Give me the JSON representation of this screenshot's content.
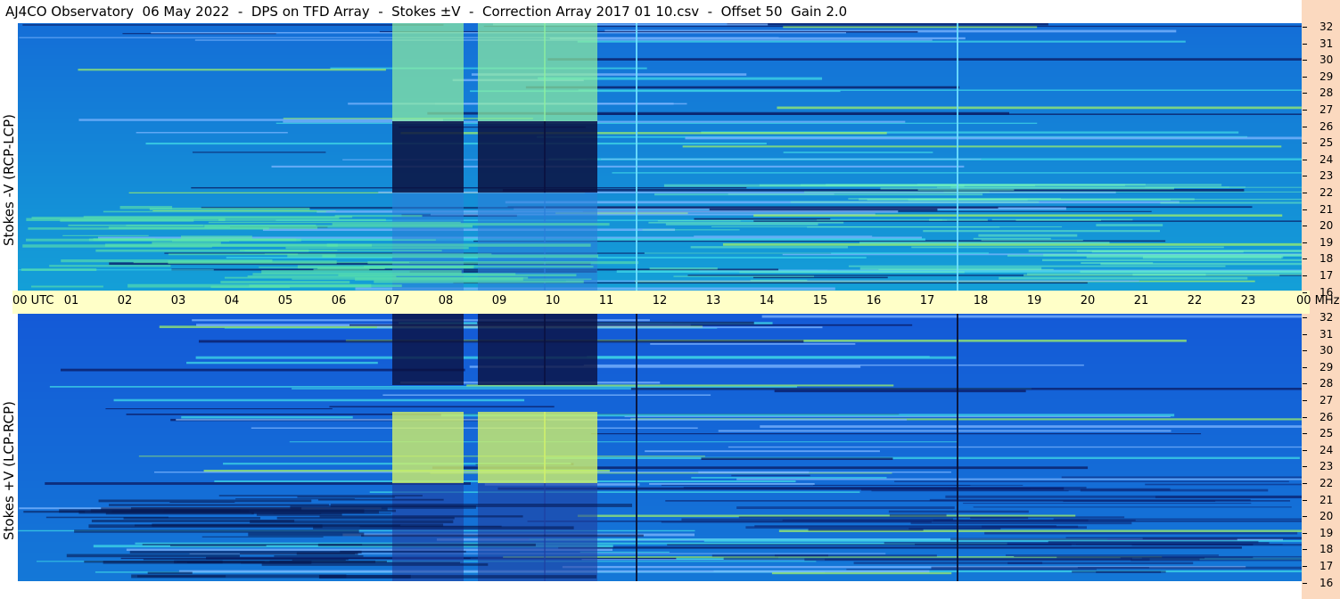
{
  "title": "AJ4CO Observatory  06 May 2022  -  DPS on TFD Array  -  Stokes ±V  -  Correction Array 2017 01 10.csv  -  Offset 50  Gain 2.0",
  "chart_data": {
    "type": "heatmap",
    "title": "AJ4CO Observatory  06 May 2022  -  DPS on TFD Array  -  Stokes ±V  -  Correction Array 2017 01 10.csv  -  Offset 50  Gain 2.0",
    "x_axis": {
      "tick_labels": [
        "00 UTC",
        "01",
        "02",
        "03",
        "04",
        "05",
        "06",
        "07",
        "08",
        "09",
        "10",
        "11",
        "12",
        "13",
        "14",
        "15",
        "16",
        "17",
        "18",
        "19",
        "20",
        "21",
        "22",
        "23",
        "00 MHz"
      ],
      "range_hours_utc": [
        0,
        24
      ]
    },
    "y_axis": {
      "tick_labels": [
        "32",
        "31",
        "30",
        "29",
        "28",
        "27",
        "26",
        "25",
        "24",
        "23",
        "22",
        "21",
        "20",
        "19",
        "18",
        "17",
        "16"
      ],
      "range_mhz": [
        16,
        32
      ]
    },
    "panels": [
      {
        "label": "Stokes -V (RCP-LCP)",
        "polarity": "negative"
      },
      {
        "label": "Stokes +V (LCP-RCP)",
        "polarity": "positive"
      }
    ],
    "grid": false,
    "colors": {
      "background": "#1e6fd9",
      "timebar": "#ffffc8",
      "scale_strip": "#fbd9bf"
    }
  }
}
